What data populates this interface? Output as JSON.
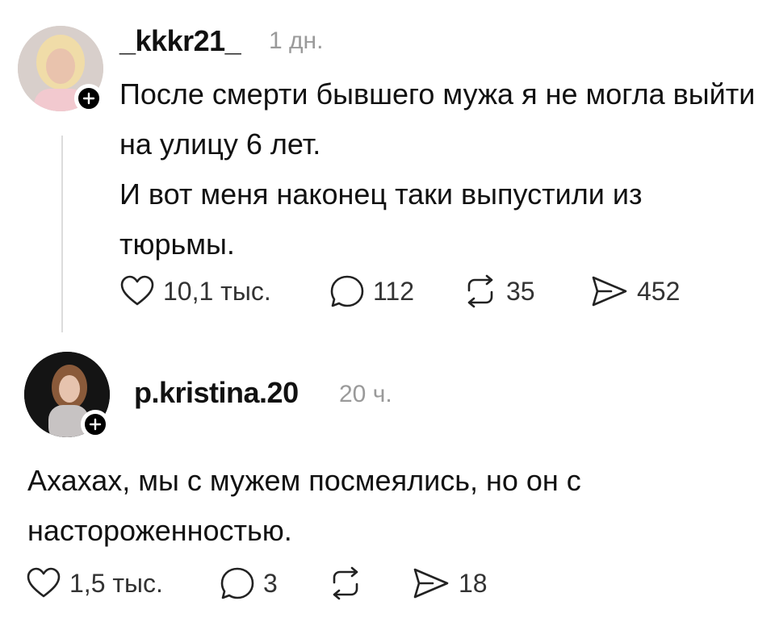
{
  "post": {
    "username": "_kkkr21_",
    "time": "1 дн.",
    "paragraphs": [
      "После смерти бывшего мужа я не могла выйти на улицу 6 лет.",
      "И вот меня наконец таки выпустили из тюрьмы."
    ],
    "likes": "10,1 тыс.",
    "comments": "112",
    "reposts": "35",
    "shares": "452"
  },
  "reply": {
    "username": "p.kristina.20",
    "time": "20 ч.",
    "text": "Ахахах, мы с мужем посмеялись, но он с настороженностью.",
    "likes": "1,5 тыс.",
    "comments": "3",
    "reposts": "",
    "shares": "18"
  },
  "icons": [
    "heart-icon",
    "comment-icon",
    "repost-icon",
    "share-icon",
    "plus-icon"
  ]
}
